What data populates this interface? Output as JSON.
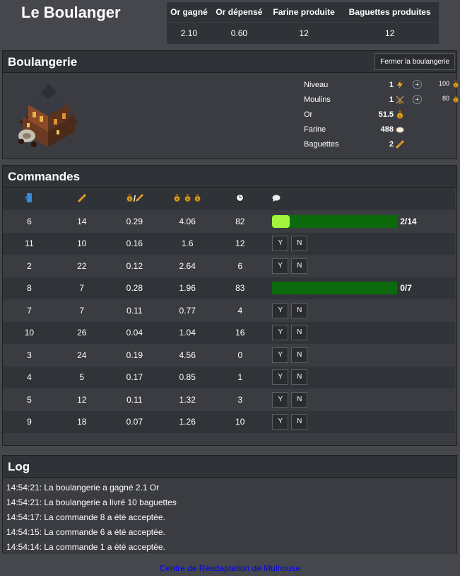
{
  "title": "Le Boulanger",
  "stats": {
    "headers": [
      "Or gagné",
      "Or dépensé",
      "Farine produite",
      "Baguettes produites"
    ],
    "values": [
      "2.10",
      "0.60",
      "12",
      "12"
    ]
  },
  "bakery": {
    "title": "Boulangerie",
    "close_button": "Fermer la boulangerie",
    "resources": [
      {
        "label": "Niveau",
        "value": "1",
        "icon": "lightning-icon",
        "upgradable": true,
        "cost": "100"
      },
      {
        "label": "Moulins",
        "value": "1",
        "icon": "windmill-icon",
        "upgradable": true,
        "cost": "80"
      },
      {
        "label": "Or",
        "value": "51.5",
        "icon": "gold-coin-icon",
        "upgradable": false,
        "cost": ""
      },
      {
        "label": "Farine",
        "value": "488",
        "icon": "flour-bag-icon",
        "upgradable": false,
        "cost": ""
      },
      {
        "label": "Baguettes",
        "value": "2",
        "icon": "baguette-icon",
        "upgradable": false,
        "cost": ""
      }
    ]
  },
  "orders": {
    "title": "Commandes",
    "column_icons": [
      "customer-icon",
      "baguette-icon",
      "gold-per-baguette-icon",
      "total-gold-icon",
      "clock-icon",
      "status-icon"
    ],
    "rows": [
      {
        "id": "6",
        "baguettes": "14",
        "price": "0.29",
        "total": "4.06",
        "time": "82",
        "state": "progress",
        "progress_value": 2,
        "progress_max": 14,
        "progress_text": "2/14"
      },
      {
        "id": "11",
        "baguettes": "10",
        "price": "0.16",
        "total": "1.6",
        "time": "12",
        "state": "pending"
      },
      {
        "id": "2",
        "baguettes": "22",
        "price": "0.12",
        "total": "2.64",
        "time": "6",
        "state": "pending"
      },
      {
        "id": "8",
        "baguettes": "7",
        "price": "0.28",
        "total": "1.96",
        "time": "83",
        "state": "progress",
        "progress_value": 0,
        "progress_max": 7,
        "progress_text": "0/7"
      },
      {
        "id": "7",
        "baguettes": "7",
        "price": "0.11",
        "total": "0.77",
        "time": "4",
        "state": "pending"
      },
      {
        "id": "10",
        "baguettes": "26",
        "price": "0.04",
        "total": "1.04",
        "time": "16",
        "state": "pending"
      },
      {
        "id": "3",
        "baguettes": "24",
        "price": "0.19",
        "total": "4.56",
        "time": "0",
        "state": "pending"
      },
      {
        "id": "4",
        "baguettes": "5",
        "price": "0.17",
        "total": "0.85",
        "time": "1",
        "state": "pending"
      },
      {
        "id": "5",
        "baguettes": "12",
        "price": "0.11",
        "total": "1.32",
        "time": "3",
        "state": "pending"
      },
      {
        "id": "9",
        "baguettes": "18",
        "price": "0.07",
        "total": "1.26",
        "time": "10",
        "state": "pending"
      }
    ],
    "yes_label": "Y",
    "no_label": "N"
  },
  "log": {
    "title": "Log",
    "lines": [
      "14:54:21: La boulangerie a gagné 2.1 Or",
      "14:54:21: La boulangerie a livré 10 baguettes",
      "14:54:17: La commande 8 a été acceptée.",
      "14:54:15: La commande 6 a été acceptée.",
      "14:54:14: La commande 1 a été acceptée."
    ]
  },
  "footer": {
    "link": "Centre de Réadaptation de Mulhouse"
  },
  "colors": {
    "progress_track": "#0c6a0c",
    "progress_fill": "#a4f53e",
    "link": "#0000ee"
  }
}
